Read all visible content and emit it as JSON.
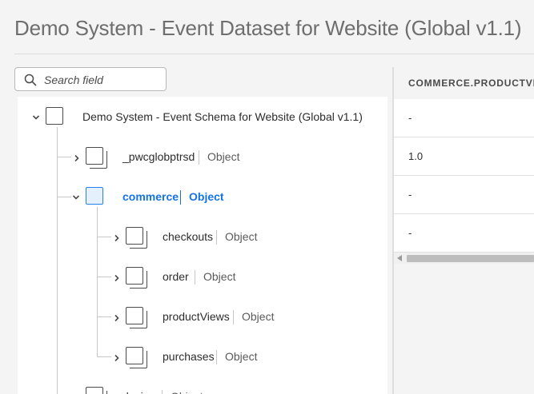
{
  "page": {
    "title": "Demo System - Event Dataset for Website (Global v1.1)"
  },
  "search": {
    "placeholder": "Search field"
  },
  "tree": {
    "root": {
      "label": "Demo System - Event Schema for Website (Global v1.1)"
    },
    "nodes": [
      {
        "label": "_pwcglobptrsd",
        "type": "Object"
      },
      {
        "label": "commerce",
        "type": "Object",
        "selected": true
      },
      {
        "label": "checkouts",
        "type": "Object"
      },
      {
        "label": "order",
        "type": "Object"
      },
      {
        "label": "productViews",
        "type": "Object"
      },
      {
        "label": "purchases",
        "type": "Object"
      },
      {
        "label": "device",
        "type": "Object"
      }
    ]
  },
  "grid": {
    "column_header": "COMMERCE.PRODUCTVIEWS",
    "rows": [
      "-",
      "1.0",
      "-",
      "-"
    ]
  },
  "colors": {
    "accent": "#1473e6",
    "selected_bg": "#e5f0fd"
  }
}
